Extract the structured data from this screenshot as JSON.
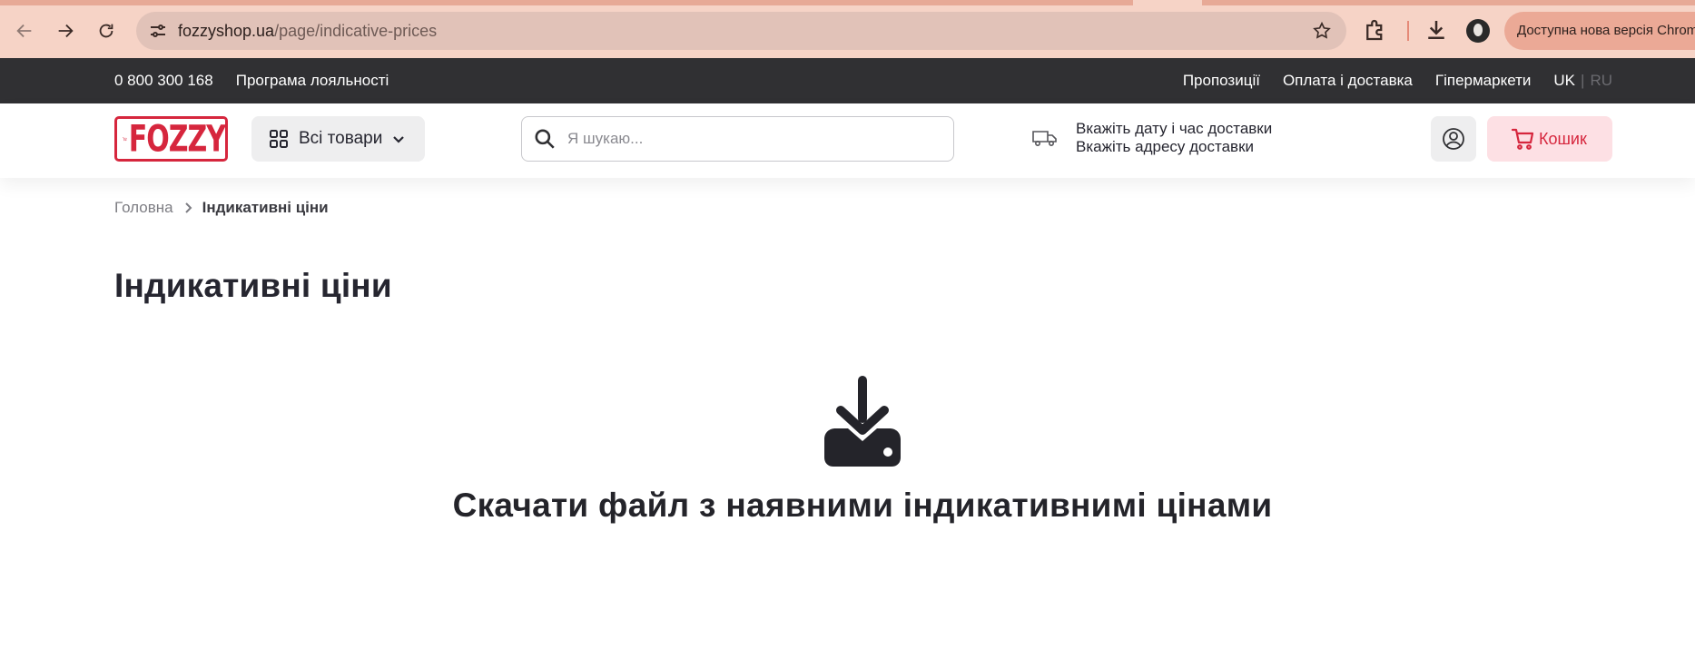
{
  "browser": {
    "url_domain": "fozzyshop.ua",
    "url_path": "/page/indicative-prices",
    "update_text": "Доступна нова версія Chrome"
  },
  "topbar": {
    "phone": "0 800 300 168",
    "loyalty": "Програма лояльності",
    "links": [
      "Пропозиції",
      "Оплата і доставка",
      "Гіпермаркети"
    ],
    "lang_uk": "UK",
    "lang_sep": "|",
    "lang_ru": "RU"
  },
  "header": {
    "logo_text": "FOZZY",
    "catalog_label": "Всі товари",
    "search_placeholder": "Я шукаю...",
    "delivery_time": "Вкажіть дату і час доставки",
    "delivery_address": "Вкажіть адресу доставки",
    "cart_label": "Кошик"
  },
  "breadcrumb": {
    "home": "Головна",
    "current": "Індикативні ціни"
  },
  "main": {
    "title": "Індикативні ціни",
    "download_text": "Скачати файл з наявними індикативнимі цінами"
  },
  "colors": {
    "brand_red": "#d6263d",
    "topbar_bg": "#303033",
    "chrome_bg": "#f6d3c6"
  },
  "icons": [
    "arrow-back-icon",
    "arrow-forward-icon",
    "reload-icon",
    "tune-icon",
    "star-icon",
    "extensions-icon",
    "download-icon",
    "grid-icon",
    "chevron-down-icon",
    "search-icon",
    "truck-icon",
    "user-icon",
    "cart-icon",
    "chevron-right-icon",
    "file-download-icon"
  ]
}
